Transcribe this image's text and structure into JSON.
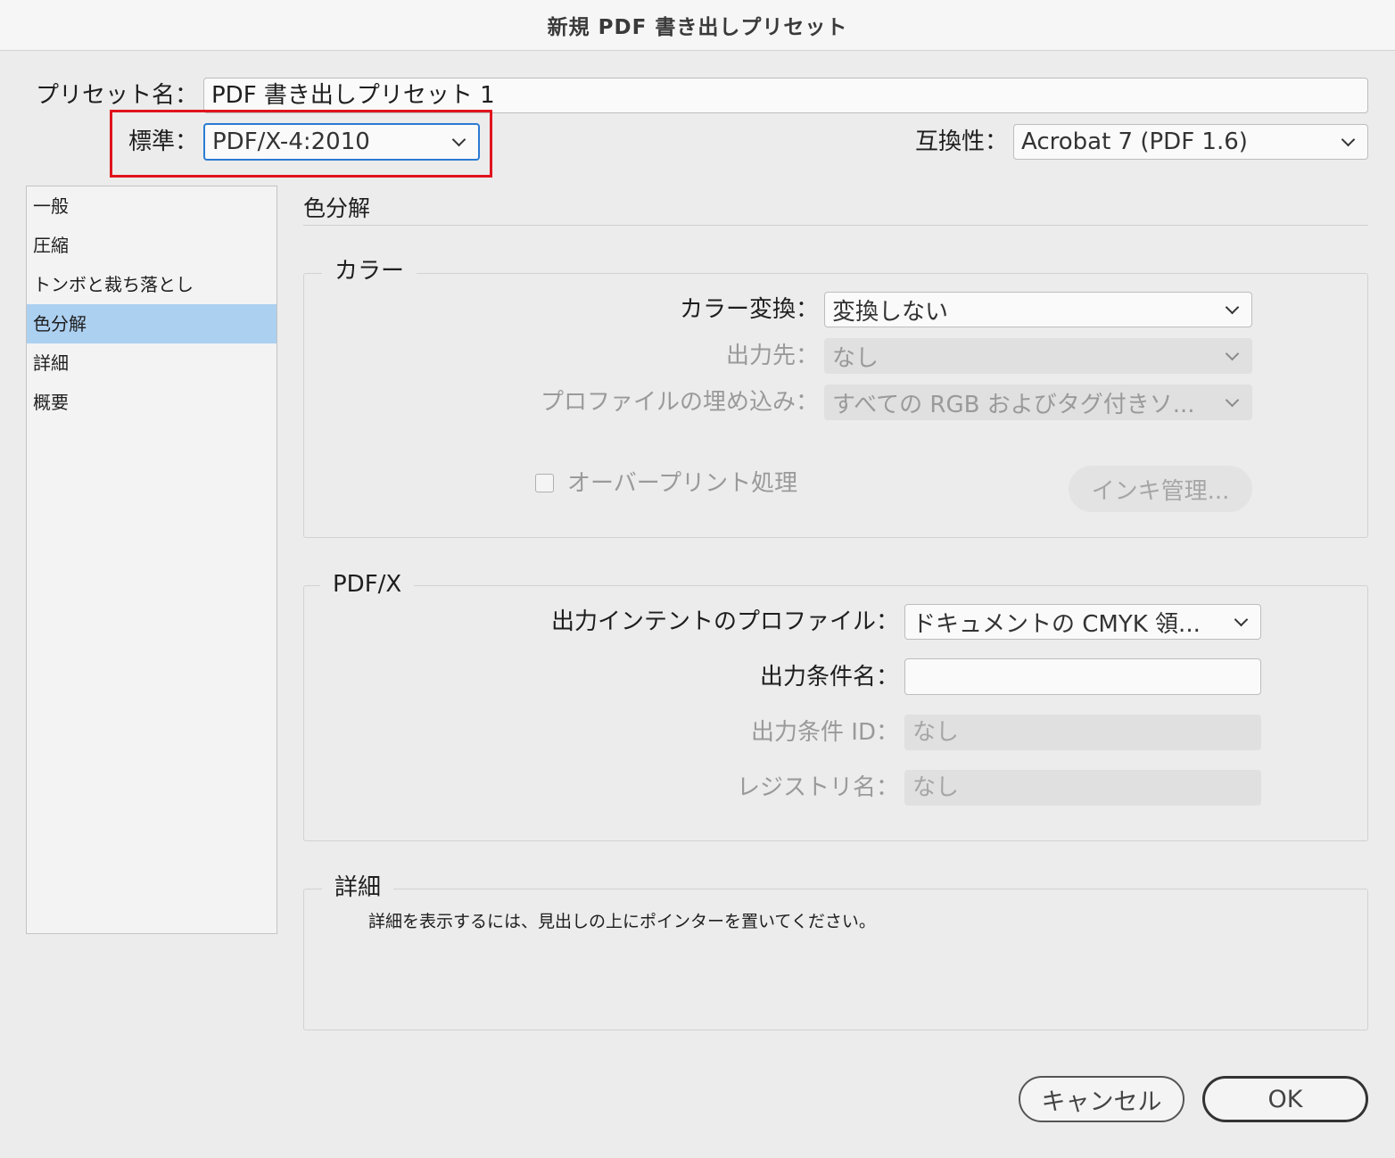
{
  "window": {
    "title": "新規 PDF 書き出しプリセット"
  },
  "header": {
    "preset_label": "プリセット名：",
    "preset_value": "PDF 書き出しプリセット 1",
    "standard_label": "標準：",
    "standard_value": "PDF/X-4:2010",
    "compat_label": "互換性：",
    "compat_value": "Acrobat 7 (PDF 1.6)"
  },
  "sidebar": {
    "items": [
      {
        "label": "一般"
      },
      {
        "label": "圧縮"
      },
      {
        "label": "トンボと裁ち落とし"
      },
      {
        "label": "色分解",
        "selected": true
      },
      {
        "label": "詳細"
      },
      {
        "label": "概要"
      }
    ]
  },
  "main": {
    "section_title": "色分解",
    "color_group": {
      "legend": "カラー",
      "conversion_label": "カラー変換：",
      "conversion_value": "変換しない",
      "destination_label": "出力先：",
      "destination_value": "なし",
      "profile_label": "プロファイルの埋め込み：",
      "profile_value": "すべての RGB およびタグ付きソ...",
      "overprint_label": "オーバープリント処理",
      "ink_button": "インキ管理..."
    },
    "pdfx_group": {
      "legend": "PDF/X",
      "intent_label": "出力インテントのプロファイル：",
      "intent_value": "ドキュメントの CMYK 領...",
      "condition_name_label": "出力条件名：",
      "condition_name_value": "",
      "condition_id_label": "出力条件 ID：",
      "condition_id_value": "なし",
      "registry_label": "レジストリ名：",
      "registry_value": "なし"
    },
    "details_group": {
      "legend": "詳細",
      "text": "詳細を表示するには、見出しの上にポインターを置いてください。"
    }
  },
  "footer": {
    "cancel_label": "キャンセル",
    "ok_label": "OK"
  },
  "colors": {
    "selection": "#acd0f0",
    "focus": "#2b7bd4",
    "highlight_box": "#e0141e"
  }
}
